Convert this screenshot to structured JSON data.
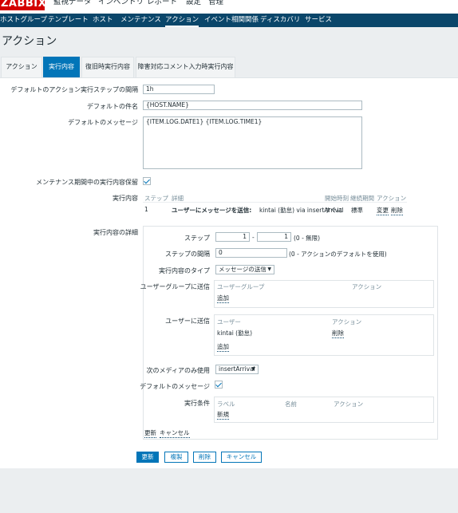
{
  "header": {
    "logo": "ZABBIX",
    "menu": [
      "監視データ",
      "インベントリ",
      "レポート",
      "設定",
      "管理"
    ],
    "subnav": [
      "ホストグループ",
      "テンプレート",
      "ホスト",
      "メンテナンス",
      "アクション",
      "イベント相関関係",
      "ディスカバリ",
      "サービス"
    ],
    "active_subnav": "アクション"
  },
  "page_title": "アクション",
  "tabs": [
    "アクション",
    "実行内容",
    "復旧時実行内容",
    "障害対応コメント入力時実行内容"
  ],
  "active_tab": "実行内容",
  "form": {
    "step_duration_label": "デフォルトのアクション実行ステップの間隔",
    "step_duration_value": "1h",
    "subject_label": "デフォルトの件名",
    "subject_value": "{HOST.NAME}",
    "message_label": "デフォルトのメッセージ",
    "message_value": "{ITEM.LOG.DATE1} {ITEM.LOG.TIME1}",
    "pause_label": "メンテナンス期間中の実行内容保留",
    "pause_checked": true,
    "operations_label": "実行内容",
    "operations_headers": {
      "steps": "ステップ",
      "details": "詳細",
      "start_in": "開始時刻",
      "duration": "継続期間",
      "action": "アクション"
    },
    "operations_rows": [
      {
        "step": "1",
        "detail_bold": "ユーザーにメッセージを送信:",
        "detail_rest": " kintai (勤怠) via insertArrival",
        "start_in": "すぐに",
        "duration": "標準",
        "edit": "変更",
        "remove": "削除"
      }
    ]
  },
  "operation_details": {
    "label": "実行内容の詳細",
    "steps_label": "ステップ",
    "step_from": "1",
    "step_to": "1",
    "step_hint": "(0 - 無限)",
    "step_duration_label": "ステップの間隔",
    "step_duration_value": "0",
    "step_duration_hint": "(0 - アクションのデフォルトを使用)",
    "operation_type_label": "実行内容のタイプ",
    "operation_type_value": "メッセージの送信",
    "send_to_groups_label": "ユーザーグループに送信",
    "groups_header_group": "ユーザーグループ",
    "groups_header_action": "アクション",
    "groups_add": "追加",
    "send_to_users_label": "ユーザーに送信",
    "users_header_user": "ユーザー",
    "users_header_action": "アクション",
    "users_rows": [
      {
        "name": "kintai (勤怠)",
        "remove": "削除"
      }
    ],
    "users_add": "追加",
    "media_label": "次のメディアのみ使用",
    "media_value": "insertArrival",
    "default_message_label": "デフォルトのメッセージ",
    "default_message_checked": true,
    "conditions_label": "実行条件",
    "conditions_header_label": "ラベル",
    "conditions_header_name": "名前",
    "conditions_header_action": "アクション",
    "conditions_new": "新規",
    "update_link": "更新",
    "cancel_link": "キャンセル"
  },
  "buttons": {
    "update": "更新",
    "clone": "複製",
    "delete": "削除",
    "cancel": "キャンセル"
  },
  "colors": {
    "logo_red": "#d40000",
    "nav_blue": "#0a466a",
    "accent_blue": "#0275b8",
    "background": "#ebeef0"
  }
}
